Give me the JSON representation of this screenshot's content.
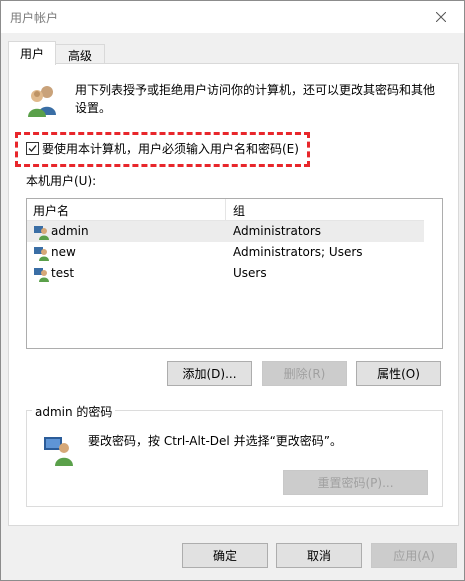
{
  "window": {
    "title": "用户帐户"
  },
  "tabs": [
    {
      "label": "用户",
      "active": true
    },
    {
      "label": "高级",
      "active": false
    }
  ],
  "intro": {
    "text": "用下列表授予或拒绝用户访问你的计算机，还可以更改其密码和其他设置。"
  },
  "require_login": {
    "label": "要使用本计算机，用户必须输入用户名和密码(E)",
    "checked": true
  },
  "local_users": {
    "label": "本机用户(U):",
    "columns": [
      "用户名",
      "组"
    ],
    "rows": [
      {
        "name": "admin",
        "group": "Administrators",
        "selected": true
      },
      {
        "name": "new",
        "group": "Administrators; Users",
        "selected": false
      },
      {
        "name": "test",
        "group": "Users",
        "selected": false
      }
    ]
  },
  "user_buttons": {
    "add": "添加(D)...",
    "remove": "删除(R)",
    "properties": "属性(O)"
  },
  "password_group": {
    "title": "admin 的密码",
    "text": "要改密码，按 Ctrl-Alt-Del 并选择“更改密码”。",
    "reset_button": "重置密码(P)..."
  },
  "dialog_buttons": {
    "ok": "确定",
    "cancel": "取消",
    "apply": "应用(A)"
  },
  "colors": {
    "highlight": "#e8262b",
    "window_bg": "#f0f0f0",
    "selected_row": "#ececec"
  },
  "icons": {
    "close": "close-icon",
    "users": "users-icon",
    "user_row": "user-icon",
    "password": "password-user-icon",
    "checkbox": "check-icon"
  }
}
